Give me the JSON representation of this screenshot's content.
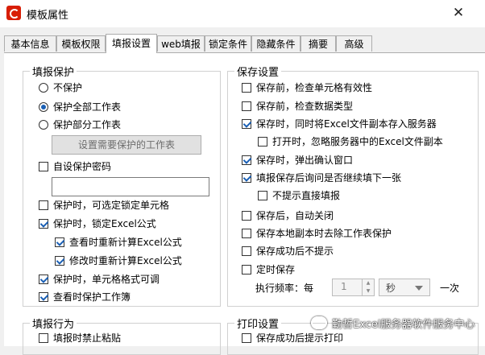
{
  "window": {
    "title": "模板属性",
    "close_glyph": "✕"
  },
  "tabs": [
    {
      "label": "基本信息",
      "active": false
    },
    {
      "label": "模板权限",
      "active": false
    },
    {
      "label": "填报设置",
      "active": true
    },
    {
      "label": "web填报",
      "active": false
    },
    {
      "label": "锁定条件",
      "active": false
    },
    {
      "label": "隐藏条件",
      "active": false
    },
    {
      "label": "摘要",
      "active": false
    },
    {
      "label": "高级",
      "active": false
    }
  ],
  "protect": {
    "title": "填报保护",
    "radios": [
      {
        "label": "不保护",
        "checked": false
      },
      {
        "label": "保护全部工作表",
        "checked": true
      },
      {
        "label": "保护部分工作表",
        "checked": false
      }
    ],
    "set_sheets_button": "设置需要保护的工作表",
    "password": {
      "label": "自设保护密码",
      "checked": false,
      "value": ""
    },
    "options": [
      {
        "label": "保护时，可选定锁定单元格",
        "checked": false
      },
      {
        "label": "保护时，锁定Excel公式",
        "checked": true
      },
      {
        "label": "查看时重新计算Excel公式",
        "checked": true
      },
      {
        "label": "修改时重新计算Excel公式",
        "checked": true
      },
      {
        "label": "保护时，单元格格式可调",
        "checked": true
      },
      {
        "label": "查看时保护工作簿",
        "checked": true
      }
    ]
  },
  "save": {
    "title": "保存设置",
    "options": [
      {
        "label": "保存前，检查单元格有效性",
        "checked": false
      },
      {
        "label": "保存前，检查数据类型",
        "checked": false
      },
      {
        "label": "保存时，同时将Excel文件副本存入服务器",
        "checked": true
      },
      {
        "label": "打开时，忽略服务器中的Excel文件副本",
        "checked": false
      },
      {
        "label": "保存时，弹出确认窗口",
        "checked": true
      },
      {
        "label": "填报保存后询问是否继续填下一张",
        "checked": true
      },
      {
        "label": "不提示直接填报",
        "checked": false
      },
      {
        "label": "保存后，自动关闭",
        "checked": false
      },
      {
        "label": "保存本地副本时去除工作表保护",
        "checked": false
      },
      {
        "label": "保存成功后不提示",
        "checked": false
      },
      {
        "label": "定时保存",
        "checked": false
      }
    ],
    "frequency": {
      "label": "执行频率：每",
      "value": "1",
      "unit": "秒",
      "suffix": "一次"
    }
  },
  "fill": {
    "title": "填报行为",
    "options": [
      {
        "label": "填报时禁止粘贴",
        "checked": false
      }
    ]
  },
  "print": {
    "title": "打印设置",
    "options": [
      {
        "label": "保存成功后提示打印",
        "checked": false
      }
    ]
  },
  "watermark": {
    "text": "勤哲Excel服务器软件服务中心"
  }
}
